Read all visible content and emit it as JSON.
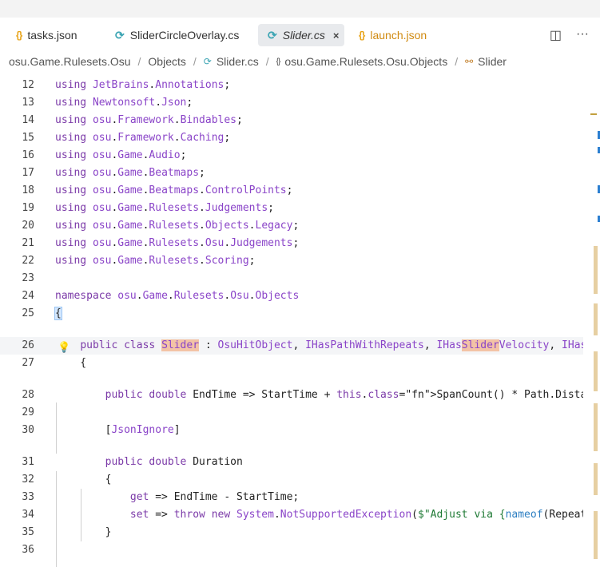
{
  "tabs": [
    {
      "label": "tasks.json",
      "icon": "{}"
    },
    {
      "label": "SliderCircleOverlay.cs",
      "icon": "C#"
    },
    {
      "label": "Slider.cs",
      "icon": "C#",
      "close": "×"
    },
    {
      "label": "launch.json",
      "icon": "{}"
    }
  ],
  "tab_actions": {
    "split": "◫",
    "more": "···"
  },
  "breadcrumb": {
    "items": [
      "osu.Game.Rulesets.Osu",
      "Objects",
      "Slider.cs",
      "osu.Game.Rulesets.Osu.Objects",
      "Slider"
    ],
    "separator": "/"
  },
  "code": {
    "lines": [
      {
        "n": "12",
        "t": "using JetBrains.Annotations;"
      },
      {
        "n": "13",
        "t": "using Newtonsoft.Json;"
      },
      {
        "n": "14",
        "t": "using osu.Framework.Bindables;"
      },
      {
        "n": "15",
        "t": "using osu.Framework.Caching;"
      },
      {
        "n": "16",
        "t": "using osu.Game.Audio;"
      },
      {
        "n": "17",
        "t": "using osu.Game.Beatmaps;"
      },
      {
        "n": "18",
        "t": "using osu.Game.Beatmaps.ControlPoints;"
      },
      {
        "n": "19",
        "t": "using osu.Game.Rulesets.Judgements;"
      },
      {
        "n": "20",
        "t": "using osu.Game.Rulesets.Objects.Legacy;"
      },
      {
        "n": "21",
        "t": "using osu.Game.Rulesets.Osu.Judgements;"
      },
      {
        "n": "22",
        "t": "using osu.Game.Rulesets.Scoring;"
      },
      {
        "n": "23",
        "t": ""
      },
      {
        "n": "24",
        "t": "namespace osu.Game.Rulesets.Osu.Objects"
      },
      {
        "n": "25",
        "t": "{"
      },
      {
        "n": "26",
        "t": "    public class Slider : OsuHitObject, IHasPathWithRepeats, IHasSliderVelocity, IHasG"
      },
      {
        "n": "27",
        "t": "    {"
      },
      {
        "n": "28",
        "t": "        public double EndTime => StartTime + this.SpanCount() * Path.Distance / Veloci"
      },
      {
        "n": "29",
        "t": ""
      },
      {
        "n": "30",
        "t": "        [JsonIgnore]"
      },
      {
        "n": "31",
        "t": "        public double Duration"
      },
      {
        "n": "32",
        "t": "        {"
      },
      {
        "n": "33",
        "t": "            get => EndTime - StartTime;"
      },
      {
        "n": "34",
        "t": "            set => throw new System.NotSupportedException($\"Adjust via {nameof(RepeatC"
      },
      {
        "n": "35",
        "t": "        }"
      },
      {
        "n": "36",
        "t": ""
      }
    ]
  },
  "colors": {
    "keyword": "#7b3aa8",
    "namespace": "#8a44c8",
    "method": "#2e7fc2",
    "string": "#1f7a35",
    "highlight": "#f3c3a6",
    "bracket_match": "#d3e7ff"
  },
  "icons": {
    "lightbulb": "lightbulb-icon"
  }
}
